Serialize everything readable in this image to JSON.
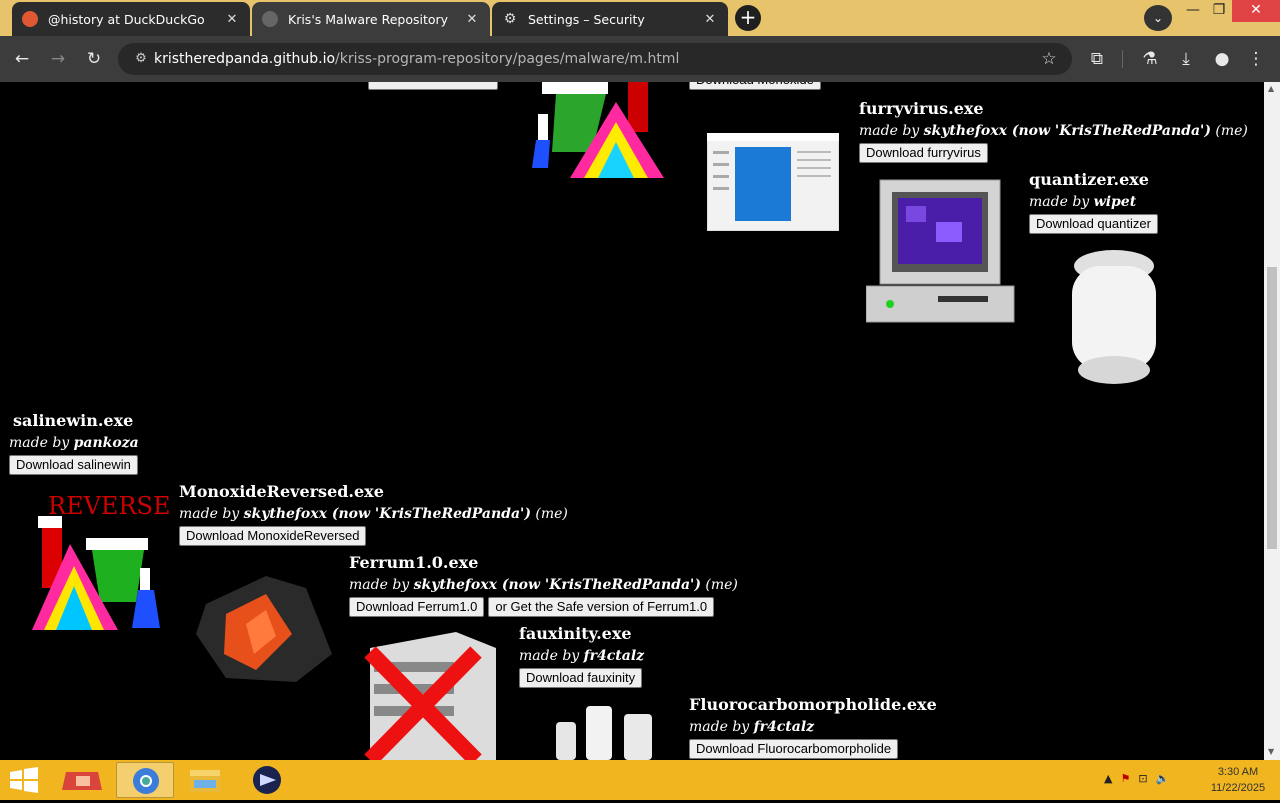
{
  "colors": {
    "tabbar": "#e7c46b",
    "toolbar": "#3c3c3c",
    "page_bg": "#000000",
    "taskbar": "#f0b51f"
  },
  "tabs": [
    {
      "title": "@history at DuckDuckGo",
      "icon": "duckduckgo-icon",
      "active": false
    },
    {
      "title": "Kris's Malware Repository",
      "icon": "globe-icon",
      "active": true
    },
    {
      "title": "Settings – Security",
      "icon": "gear-icon",
      "active": false
    }
  ],
  "address_bar": {
    "domain": "kristheredpanda.github.io",
    "path": "/kriss-program-repository/pages/malware/m.html"
  },
  "entries": {
    "monoxide_top": {
      "button": "Download Monoxide"
    },
    "furryvirus": {
      "name": "furryvirus.exe",
      "by_prefix": "made by ",
      "author": "skythefoxx (now 'KrisTheRedPanda')",
      "suffix": " (me)",
      "button": "Download furryvirus"
    },
    "quantizer": {
      "name": "quantizer.exe",
      "by_prefix": "made by ",
      "author": "wipet",
      "button": "Download quantizer"
    },
    "salinewin": {
      "name": "salinewin.exe",
      "by_prefix": "made by ",
      "author": "pankoza",
      "button": "Download salinewin"
    },
    "monoxide_reversed": {
      "name": "MonoxideReversed.exe",
      "by_prefix": "made by ",
      "author": "skythefoxx (now 'KrisTheRedPanda')",
      "suffix": " (me)",
      "button": "Download MonoxideReversed",
      "logo_text": "REVERSED"
    },
    "ferrum": {
      "name": "Ferrum1.0.exe",
      "by_prefix": "made by ",
      "author": "skythefoxx (now 'KrisTheRedPanda')",
      "suffix": " (me)",
      "button": "Download Ferrum1.0",
      "button2": "or Get the Safe version of Ferrum1.0"
    },
    "fauxinity": {
      "name": "fauxinity.exe",
      "by_prefix": "made by ",
      "author": "fr4ctalz",
      "button": "Download fauxinity"
    },
    "fluoro": {
      "name": "Fluorocarbomorpholide.exe",
      "by_prefix": "made by ",
      "author": "fr4ctalz",
      "button": "Download Fluorocarbomorpholide"
    }
  },
  "taskbar": {
    "apps": [
      "app-icon",
      "chrome-icon",
      "file-explorer-icon",
      "media-icon"
    ],
    "clock": {
      "time": "3:30 AM",
      "date": "11/22/2025"
    }
  }
}
